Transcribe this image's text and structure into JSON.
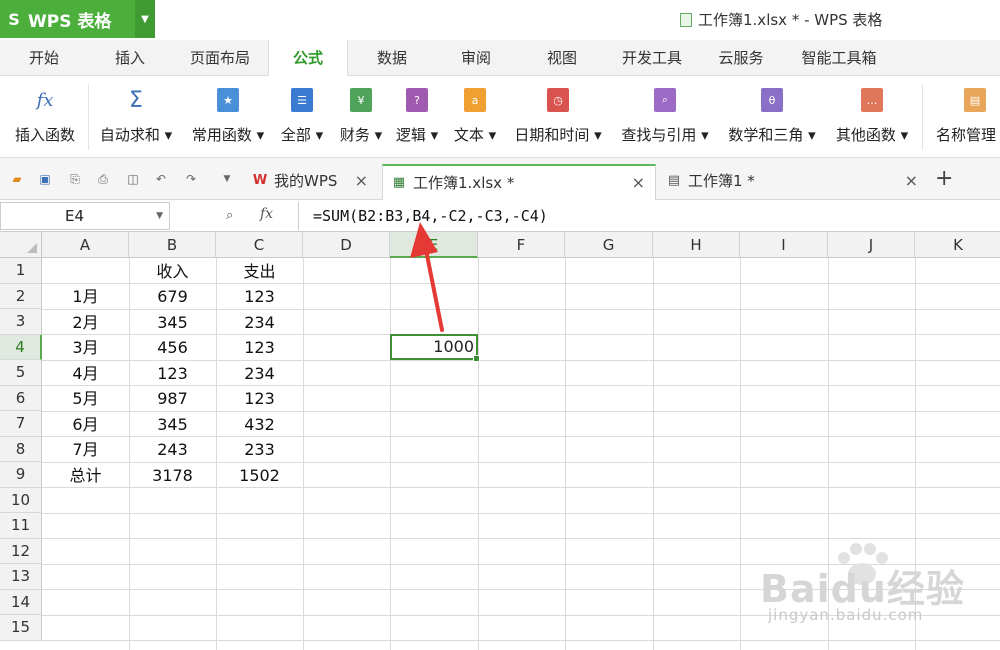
{
  "app": {
    "name": "WPS 表格",
    "logo": "S"
  },
  "window_title": "工作簿1.xlsx * - WPS 表格",
  "menu_tabs": [
    "开始",
    "插入",
    "页面布局",
    "公式",
    "数据",
    "审阅",
    "视图",
    "开发工具",
    "云服务",
    "智能工具箱"
  ],
  "active_menu_tab": "公式",
  "ribbon": {
    "insert_function": "插入函数",
    "autosum": "自动求和",
    "common": "常用函数",
    "all": "全部",
    "finance": "财务",
    "logic": "逻辑",
    "text": "文本",
    "datetime": "日期和时间",
    "lookup": "查找与引用",
    "math": "数学和三角",
    "other": "其他函数",
    "name_manager": "名称管理"
  },
  "doc_tabs": [
    {
      "label": "我的WPS"
    },
    {
      "label": "工作簿1.xlsx *"
    },
    {
      "label": "工作簿1 *"
    }
  ],
  "formula_bar": {
    "cell_ref": "E4",
    "formula": "=SUM(B2:B3,B4,-C2,-C3,-C4)"
  },
  "columns": [
    "A",
    "B",
    "C",
    "D",
    "E",
    "F",
    "G",
    "H",
    "I",
    "J",
    "K"
  ],
  "rows": [
    "1",
    "2",
    "3",
    "4",
    "5",
    "6",
    "7",
    "8",
    "9",
    "10",
    "11",
    "12",
    "13",
    "14",
    "15"
  ],
  "table": {
    "header": [
      "",
      "收入",
      "支出"
    ],
    "rows": [
      [
        "1月",
        "679",
        "123"
      ],
      [
        "2月",
        "345",
        "234"
      ],
      [
        "3月",
        "456",
        "123"
      ],
      [
        "4月",
        "123",
        "234"
      ],
      [
        "5月",
        "987",
        "123"
      ],
      [
        "6月",
        "345",
        "432"
      ],
      [
        "7月",
        "243",
        "233"
      ],
      [
        "总计",
        "3178",
        "1502"
      ]
    ]
  },
  "e4_value": "1000",
  "watermark": {
    "brand": "Baidu经验",
    "url": "jingyan.baidu.com"
  },
  "colors": {
    "accent": "#4caf3c",
    "active_tab": "#2e9a27",
    "arrow": "#e53935"
  }
}
